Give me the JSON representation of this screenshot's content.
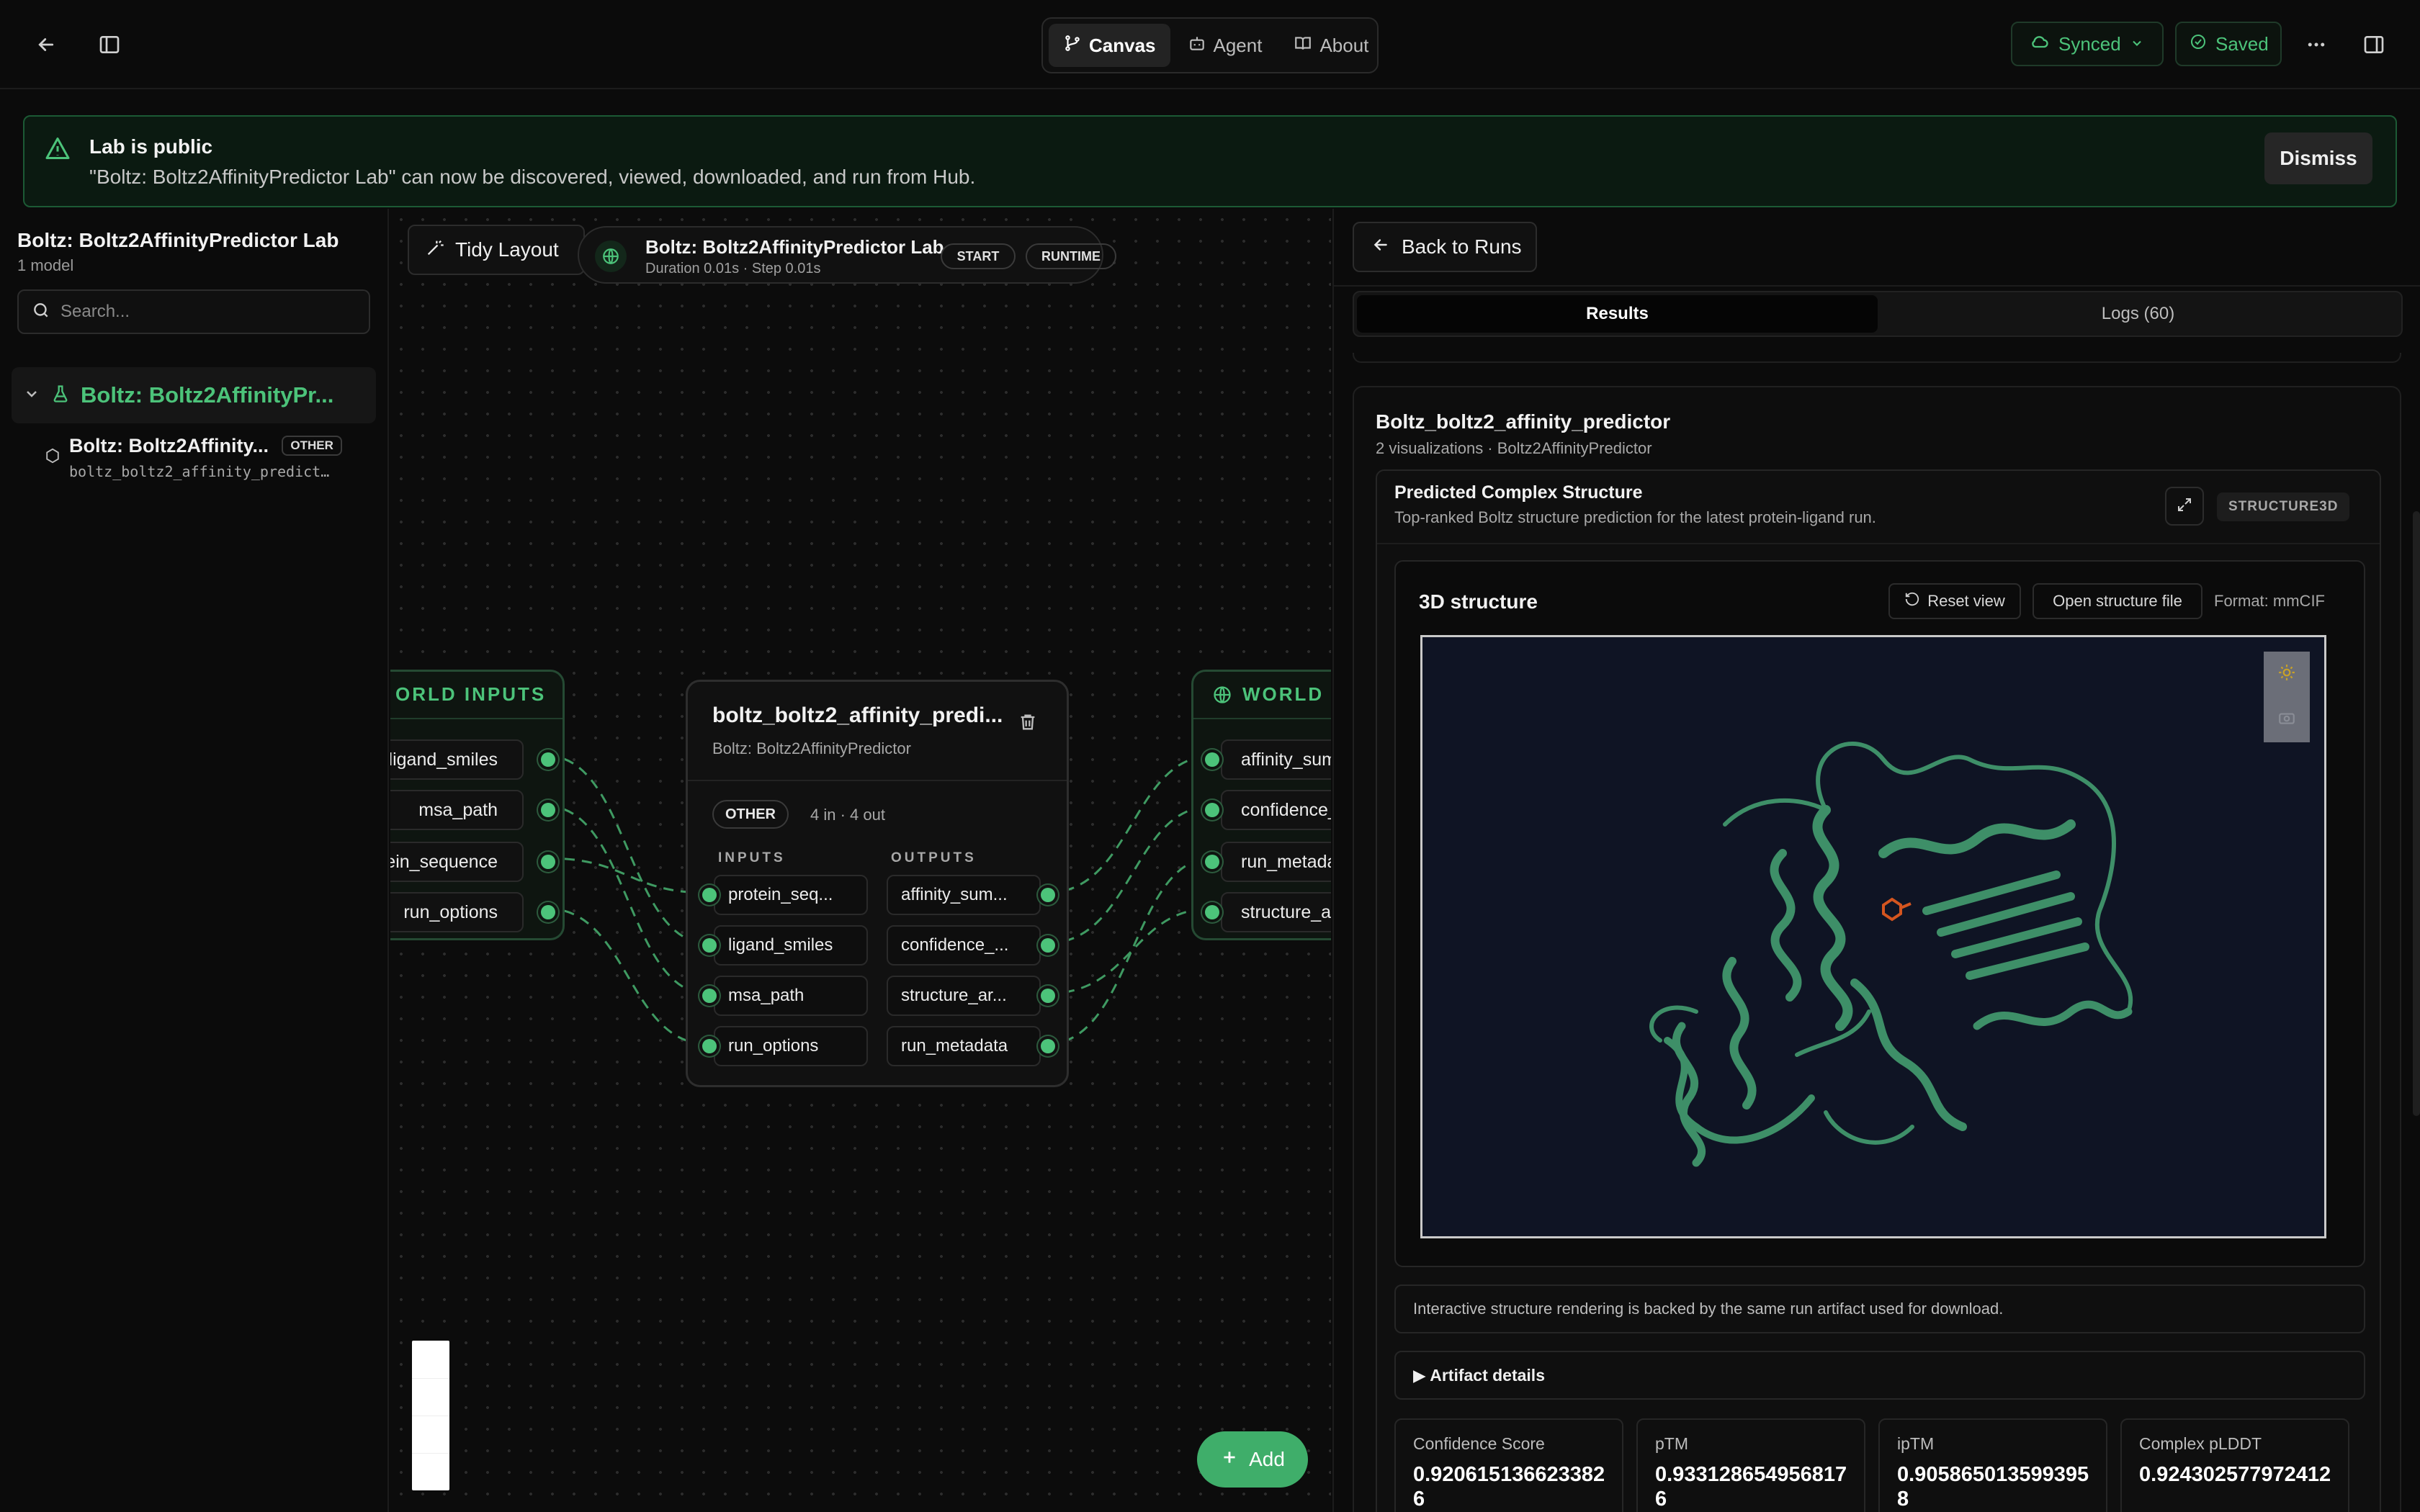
{
  "topbar": {
    "tabs": [
      {
        "label": "Canvas",
        "icon": "branch-icon",
        "active": true
      },
      {
        "label": "Agent",
        "icon": "bot-icon",
        "active": false
      },
      {
        "label": "About",
        "icon": "book-icon",
        "active": false
      }
    ],
    "synced_label": "Synced",
    "saved_label": "Saved"
  },
  "banner": {
    "title": "Lab is public",
    "message": "\"Boltz: Boltz2AffinityPredictor Lab\" can now be discovered, viewed, downloaded, and run from Hub.",
    "dismiss_label": "Dismiss"
  },
  "sidebar": {
    "lab_title": "Boltz: Boltz2AffinityPredictor Lab",
    "lab_subtitle": "1 model",
    "search_placeholder": "Search...",
    "group_label": "Boltz: Boltz2AffinityPr...",
    "item": {
      "name": "Boltz: Boltz2Affinity...",
      "tag": "OTHER",
      "id": "boltz_boltz2_affinity_predict…"
    }
  },
  "canvas": {
    "tidy_label": "Tidy Layout",
    "run": {
      "title": "Boltz: Boltz2AffinityPredictor Lab",
      "meta": "Duration 0.01s · Step 0.01s",
      "start_label": "START",
      "runtime_label": "RUNTIME"
    },
    "world_inputs": {
      "title": "ORLD INPUTS",
      "ports": [
        "ligand_smiles",
        "msa_path",
        "otein_sequence",
        "run_options"
      ]
    },
    "model_node": {
      "title": "boltz_boltz2_affinity_predi...",
      "subtitle": "Boltz: Boltz2AffinityPredictor",
      "tag": "OTHER",
      "count": "4 in · 4 out",
      "inputs_label": "INPUTS",
      "outputs_label": "OUTPUTS",
      "inputs": [
        "protein_seq...",
        "ligand_smiles",
        "msa_path",
        "run_options"
      ],
      "outputs": [
        "affinity_sum...",
        "confidence_...",
        "structure_ar...",
        "run_metadata"
      ]
    },
    "world_outputs": {
      "title": "WORLD O",
      "ports": [
        "affinity_sum",
        "confidence_",
        "run_metada",
        "structure_a"
      ]
    },
    "add_label": "Add"
  },
  "panel": {
    "back_label": "Back to Runs",
    "tabs": [
      {
        "label": "Results",
        "active": true
      },
      {
        "label": "Logs (60)",
        "active": false
      }
    ],
    "result": {
      "title": "Boltz_boltz2_affinity_predictor",
      "subtitle": "2 visualizations · Boltz2AffinityPredictor",
      "viz_title": "Predicted Complex Structure",
      "viz_desc": "Top-ranked Boltz structure prediction for the latest protein-ligand run.",
      "viz_tag": "STRUCTURE3D",
      "structure_title": "3D structure",
      "reset_label": "Reset view",
      "open_label": "Open structure file",
      "format_label": "Format: mmCIF",
      "note": "Interactive structure rendering is backed by the same run artifact used for download.",
      "artifact_label": "▶ Artifact details",
      "metrics": [
        {
          "label": "Confidence Score",
          "value": "0.9206151366233826"
        },
        {
          "label": "pTM",
          "value": "0.9331286549568176"
        },
        {
          "label": "ipTM",
          "value": "0.9058650135993958"
        },
        {
          "label": "Complex pLDDT",
          "value": "0.924302577972412"
        }
      ]
    }
  },
  "colors": {
    "accent": "#4cc37a",
    "protein": "#3e8f68",
    "ligand": "#d4551f",
    "viewer_bg": "#0f1424"
  }
}
